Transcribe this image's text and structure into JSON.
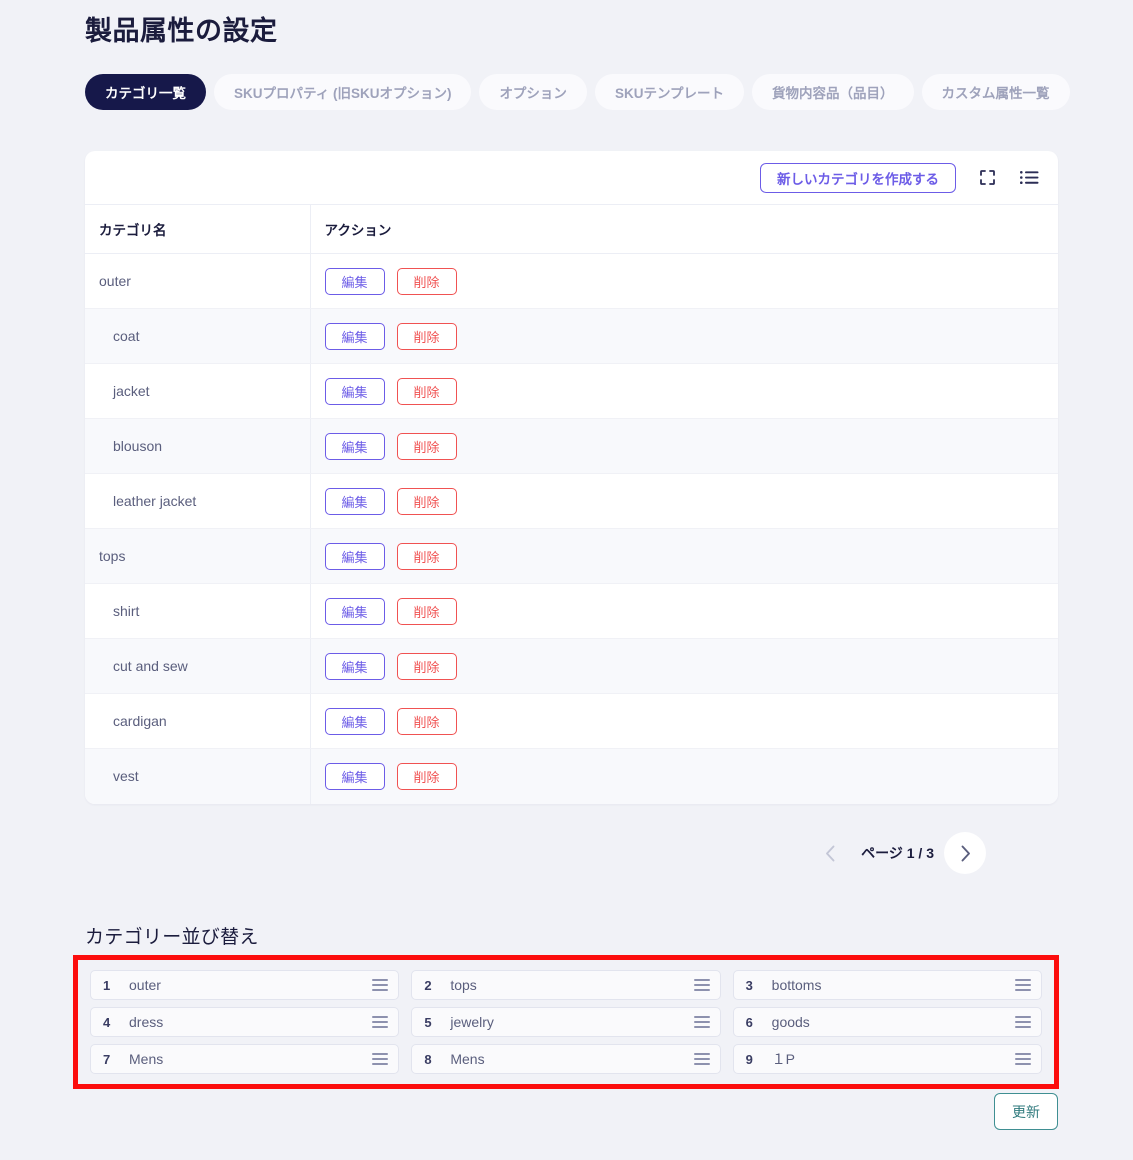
{
  "header": {
    "title": "製品属性の設定"
  },
  "tabs": [
    {
      "label": "カテゴリ一覧",
      "active": true
    },
    {
      "label": "SKUプロパティ (旧SKUオプション)",
      "active": false
    },
    {
      "label": "オプション",
      "active": false
    },
    {
      "label": "SKUテンプレート",
      "active": false
    },
    {
      "label": "貨物内容品（品目）",
      "active": false
    },
    {
      "label": "カスタム属性一覧",
      "active": false
    }
  ],
  "toolbar": {
    "create_label": "新しいカテゴリを作成する",
    "fullscreen_icon": "fullscreen-icon",
    "list_icon": "list-view-icon"
  },
  "table": {
    "headers": {
      "name": "カテゴリ名",
      "action": "アクション"
    },
    "edit_label": "編集",
    "delete_label": "削除",
    "rows": [
      {
        "name": "outer",
        "level": 0
      },
      {
        "name": "coat",
        "level": 1
      },
      {
        "name": "jacket",
        "level": 1
      },
      {
        "name": "blouson",
        "level": 1
      },
      {
        "name": "leather jacket",
        "level": 1
      },
      {
        "name": "tops",
        "level": 0
      },
      {
        "name": "shirt",
        "level": 1
      },
      {
        "name": "cut and sew",
        "level": 1
      },
      {
        "name": "cardigan",
        "level": 1
      },
      {
        "name": "vest",
        "level": 1
      }
    ]
  },
  "pagination": {
    "label": "ページ 1 / 3",
    "current_page": 1,
    "total_pages": 3,
    "prev_icon": "chevron-left-icon",
    "next_icon": "chevron-right-icon"
  },
  "reorder": {
    "title": "カテゴリー並び替え",
    "highlight_color": "#fc0d0d",
    "items": [
      {
        "num": "1",
        "label": "outer"
      },
      {
        "num": "2",
        "label": "tops"
      },
      {
        "num": "3",
        "label": "bottoms"
      },
      {
        "num": "4",
        "label": "dress"
      },
      {
        "num": "5",
        "label": "jewelry"
      },
      {
        "num": "6",
        "label": "goods"
      },
      {
        "num": "7",
        "label": "Mens"
      },
      {
        "num": "8",
        "label": "Mens"
      },
      {
        "num": "9",
        "label": "１P"
      }
    ]
  },
  "footer": {
    "update_label": "更新"
  },
  "colors": {
    "accent_purple": "#6c5ce7",
    "danger_red": "#f05252",
    "teal": "#2f7a7d",
    "dark_navy": "#16184a",
    "page_bg": "#f1f2f7"
  }
}
